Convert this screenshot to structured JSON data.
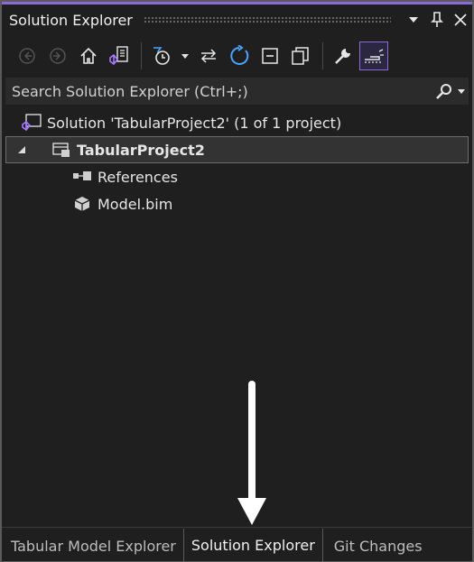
{
  "window": {
    "title": "Solution Explorer",
    "accent_color": "#8b6ad8"
  },
  "titlebar_buttons": [
    {
      "name": "dropdown-icon",
      "glyph": "▾"
    },
    {
      "name": "pin-icon",
      "glyph": "📌"
    },
    {
      "name": "close-icon",
      "glyph": "✕"
    }
  ],
  "toolbar": {
    "icons": [
      "back-icon",
      "forward-icon",
      "home-icon",
      "switch-views-icon",
      "pending-changes-filter-icon",
      "sync-icon",
      "refresh-icon",
      "collapse-all-icon",
      "show-all-files-icon",
      "properties-icon",
      "preview-selected-items-icon"
    ]
  },
  "search": {
    "placeholder": "Search Solution Explorer (Ctrl+;)"
  },
  "tree": {
    "solution_label": "Solution 'TabularProject2' (1 of 1 project)",
    "project_label": "TabularProject2",
    "references_label": "References",
    "model_label": "Model.bim"
  },
  "tabs": [
    {
      "label": "Tabular Model Explorer",
      "active": false
    },
    {
      "label": "Solution Explorer",
      "active": true
    },
    {
      "label": "Git Changes",
      "active": false
    }
  ]
}
